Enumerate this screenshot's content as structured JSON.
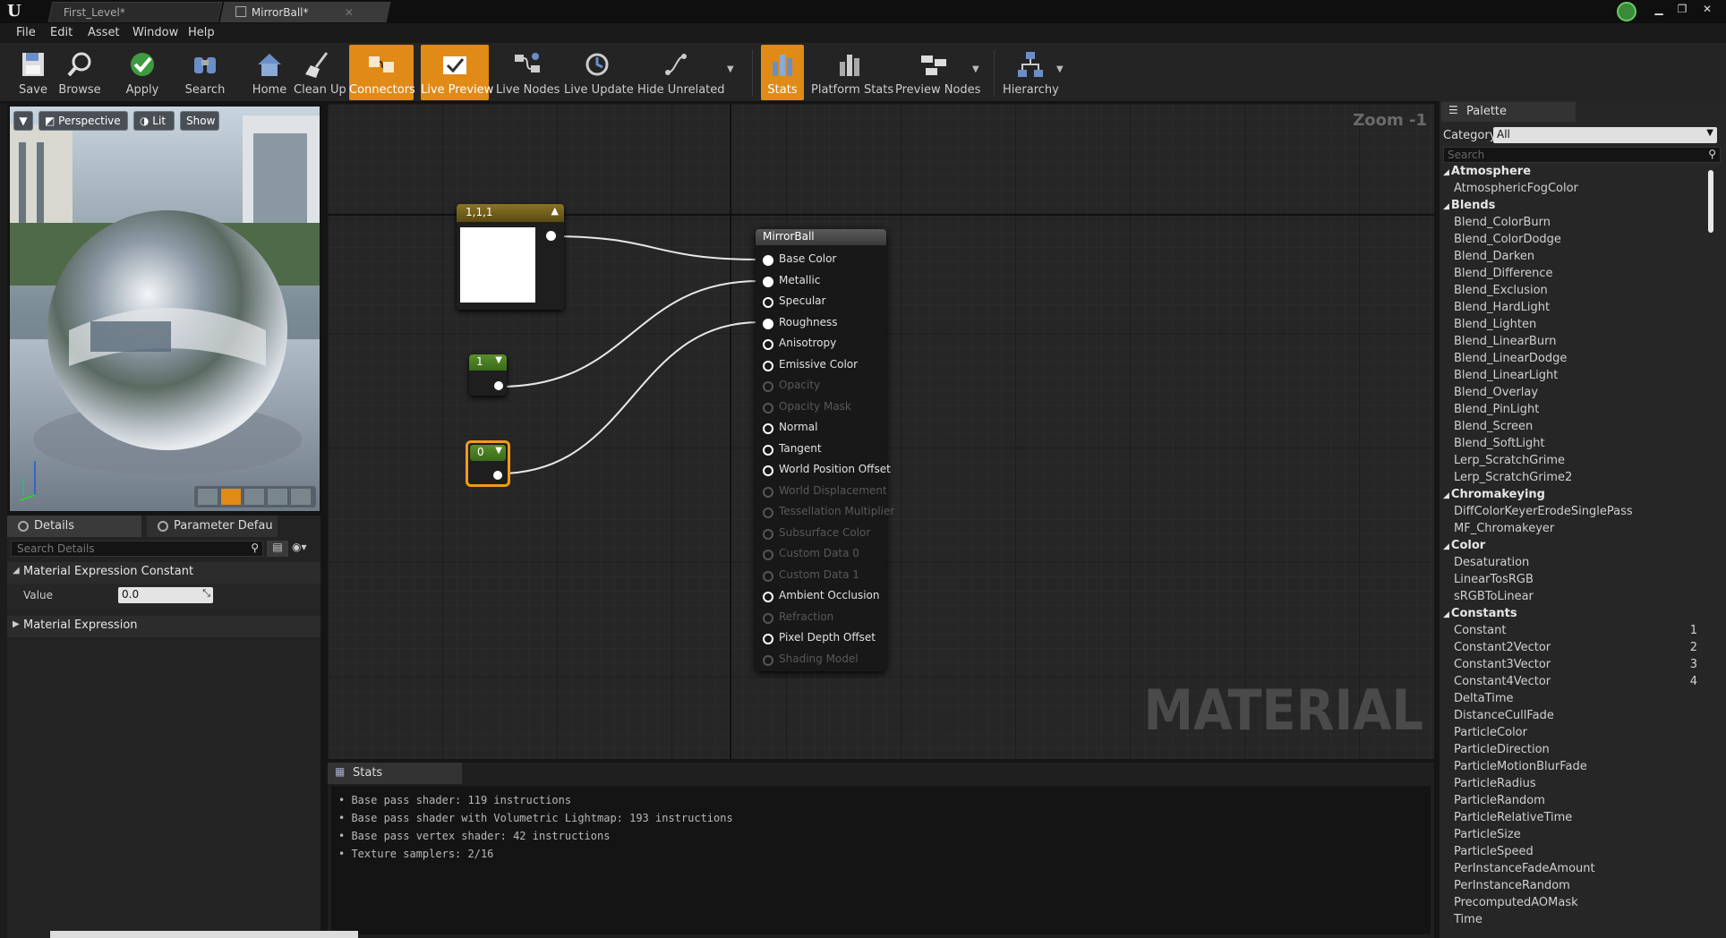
{
  "window": {
    "tabs": [
      {
        "label": "First_Level*"
      },
      {
        "label": "MirrorBall*"
      }
    ]
  },
  "menu": [
    "File",
    "Edit",
    "Asset",
    "Window",
    "Help"
  ],
  "toolbar": {
    "buttons": [
      {
        "label": "Save",
        "active": false
      },
      {
        "label": "Browse",
        "active": false
      },
      {
        "label": "Apply",
        "active": false
      },
      {
        "label": "Search",
        "active": false
      },
      {
        "label": "Home",
        "active": false
      },
      {
        "label": "Clean Up",
        "active": false
      },
      {
        "label": "Connectors",
        "active": true
      },
      {
        "label": "Live Preview",
        "active": true
      },
      {
        "label": "Live Nodes",
        "active": false
      },
      {
        "label": "Live Update",
        "active": false
      },
      {
        "label": "Hide Unrelated",
        "active": false
      },
      {
        "label": "Stats",
        "active": true
      },
      {
        "label": "Platform Stats",
        "active": false
      },
      {
        "label": "Preview Nodes",
        "active": false
      },
      {
        "label": "Hierarchy",
        "active": false
      }
    ]
  },
  "viewport": {
    "perspective_label": "Perspective",
    "lit_label": "Lit",
    "show_label": "Show"
  },
  "details": {
    "tab_details": "Details",
    "tab_params": "Parameter Defaults",
    "search_placeholder": "Search Details",
    "section1": "Material Expression Constant",
    "value_label": "Value",
    "value": "0.0",
    "section2": "Material Expression"
  },
  "graph": {
    "zoom": "Zoom -1",
    "watermark": "MATERIAL",
    "node_color_title": "1,1,1",
    "node_const1": "1",
    "node_const0": "0",
    "result_title": "MirrorBall",
    "pins": [
      {
        "label": "Base Color",
        "state": "filled"
      },
      {
        "label": "Metallic",
        "state": "filled"
      },
      {
        "label": "Specular",
        "state": "open"
      },
      {
        "label": "Roughness",
        "state": "filled"
      },
      {
        "label": "Anisotropy",
        "state": "open"
      },
      {
        "label": "Emissive Color",
        "state": "open"
      },
      {
        "label": "Opacity",
        "state": "dim"
      },
      {
        "label": "Opacity Mask",
        "state": "dim"
      },
      {
        "label": "Normal",
        "state": "open"
      },
      {
        "label": "Tangent",
        "state": "open"
      },
      {
        "label": "World Position Offset",
        "state": "open"
      },
      {
        "label": "World Displacement",
        "state": "dim"
      },
      {
        "label": "Tessellation Multiplier",
        "state": "dim"
      },
      {
        "label": "Subsurface Color",
        "state": "dim"
      },
      {
        "label": "Custom Data 0",
        "state": "dim"
      },
      {
        "label": "Custom Data 1",
        "state": "dim"
      },
      {
        "label": "Ambient Occlusion",
        "state": "open"
      },
      {
        "label": "Refraction",
        "state": "dim"
      },
      {
        "label": "Pixel Depth Offset",
        "state": "open"
      },
      {
        "label": "Shading Model",
        "state": "dim"
      }
    ]
  },
  "stats": {
    "tab": "Stats",
    "lines": [
      "Base pass shader: 119 instructions",
      "Base pass shader with Volumetric Lightmap: 193 instructions",
      "Base pass vertex shader: 42 instructions",
      "Texture samplers: 2/16"
    ]
  },
  "palette": {
    "tab": "Palette",
    "category_label": "Category:",
    "category_value": "All",
    "search_placeholder": "Search",
    "entries": [
      {
        "type": "cat",
        "label": "Atmosphere"
      },
      {
        "type": "item",
        "label": "AtmosphericFogColor"
      },
      {
        "type": "cat",
        "label": "Blends"
      },
      {
        "type": "item",
        "label": "Blend_ColorBurn"
      },
      {
        "type": "item",
        "label": "Blend_ColorDodge"
      },
      {
        "type": "item",
        "label": "Blend_Darken"
      },
      {
        "type": "item",
        "label": "Blend_Difference"
      },
      {
        "type": "item",
        "label": "Blend_Exclusion"
      },
      {
        "type": "item",
        "label": "Blend_HardLight"
      },
      {
        "type": "item",
        "label": "Blend_Lighten"
      },
      {
        "type": "item",
        "label": "Blend_LinearBurn"
      },
      {
        "type": "item",
        "label": "Blend_LinearDodge"
      },
      {
        "type": "item",
        "label": "Blend_LinearLight"
      },
      {
        "type": "item",
        "label": "Blend_Overlay"
      },
      {
        "type": "item",
        "label": "Blend_PinLight"
      },
      {
        "type": "item",
        "label": "Blend_Screen"
      },
      {
        "type": "item",
        "label": "Blend_SoftLight"
      },
      {
        "type": "item",
        "label": "Lerp_ScratchGrime"
      },
      {
        "type": "item",
        "label": "Lerp_ScratchGrime2"
      },
      {
        "type": "cat",
        "label": "Chromakeying"
      },
      {
        "type": "item",
        "label": "DiffColorKeyerErodeSinglePass"
      },
      {
        "type": "item",
        "label": "MF_Chromakeyer"
      },
      {
        "type": "cat",
        "label": "Color"
      },
      {
        "type": "item",
        "label": "Desaturation"
      },
      {
        "type": "item",
        "label": "LinearTosRGB"
      },
      {
        "type": "item",
        "label": "sRGBToLinear"
      },
      {
        "type": "cat",
        "label": "Constants"
      },
      {
        "type": "item",
        "label": "Constant",
        "hotkey": "1"
      },
      {
        "type": "item",
        "label": "Constant2Vector",
        "hotkey": "2"
      },
      {
        "type": "item",
        "label": "Constant3Vector",
        "hotkey": "3"
      },
      {
        "type": "item",
        "label": "Constant4Vector",
        "hotkey": "4"
      },
      {
        "type": "item",
        "label": "DeltaTime"
      },
      {
        "type": "item",
        "label": "DistanceCullFade"
      },
      {
        "type": "item",
        "label": "ParticleColor"
      },
      {
        "type": "item",
        "label": "ParticleDirection"
      },
      {
        "type": "item",
        "label": "ParticleMotionBlurFade"
      },
      {
        "type": "item",
        "label": "ParticleRadius"
      },
      {
        "type": "item",
        "label": "ParticleRandom"
      },
      {
        "type": "item",
        "label": "ParticleRelativeTime"
      },
      {
        "type": "item",
        "label": "ParticleSize"
      },
      {
        "type": "item",
        "label": "ParticleSpeed"
      },
      {
        "type": "item",
        "label": "PerInstanceFadeAmount"
      },
      {
        "type": "item",
        "label": "PerInstanceRandom"
      },
      {
        "type": "item",
        "label": "PrecomputedAOMask"
      },
      {
        "type": "item",
        "label": "Time"
      }
    ]
  },
  "colors": {
    "accent_orange": "#e08a18",
    "node_header_gold": "#6a5a1c",
    "node_header_green": "#4a7a2a",
    "graph_bg": "#262626"
  }
}
